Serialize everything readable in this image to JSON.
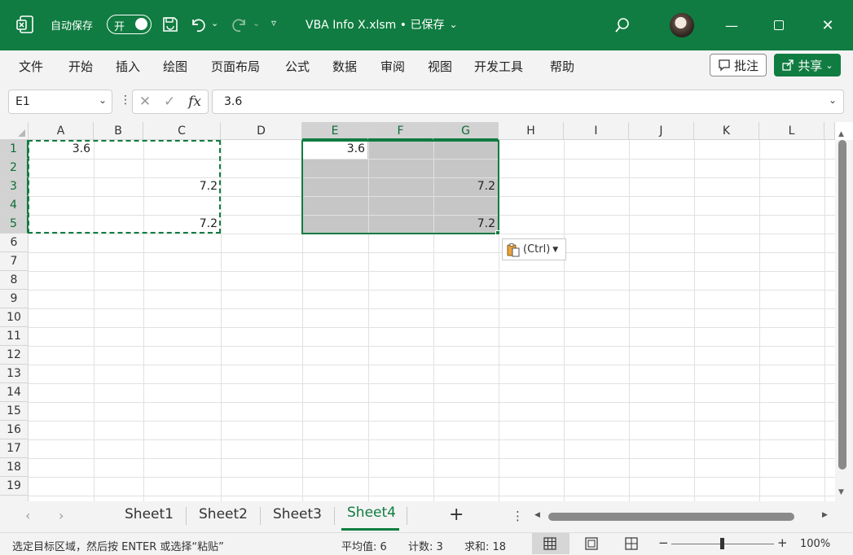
{
  "titlebar": {
    "autosave_label": "自动保存",
    "autosave_state": "开",
    "doc_title": "VBA Info X.xlsm • 已保存",
    "accent_color": "#107c41"
  },
  "menu": [
    "文件",
    "开始",
    "插入",
    "绘图",
    "页面布局",
    "公式",
    "数据",
    "审阅",
    "视图",
    "开发工具",
    "帮助"
  ],
  "actions": {
    "comment": "批注",
    "share": "共享"
  },
  "formula_bar": {
    "name_box": "E1",
    "formula": "3.6",
    "fx": "fx"
  },
  "grid": {
    "columns": [
      "A",
      "B",
      "C",
      "D",
      "E",
      "F",
      "G",
      "H",
      "I",
      "J",
      "K",
      "L"
    ],
    "rows": [
      "1",
      "2",
      "3",
      "4",
      "5",
      "6",
      "7",
      "8",
      "9",
      "10",
      "11",
      "12",
      "13",
      "14",
      "15",
      "16",
      "17",
      "18",
      "19"
    ],
    "cells": {
      "A1": "3.6",
      "C3": "7.2",
      "C5": "7.2",
      "E1": "3.6",
      "G3": "7.2",
      "G5": "7.2"
    },
    "selected_columns": [
      "E",
      "F",
      "G"
    ],
    "selected_rows": [
      "1",
      "2",
      "3",
      "4",
      "5"
    ],
    "copy_range": "A1:C5",
    "selection_range": "E1:G5"
  },
  "paste_options": {
    "label": "(Ctrl)"
  },
  "sheets": {
    "tabs": [
      "Sheet1",
      "Sheet2",
      "Sheet3",
      "Sheet4"
    ],
    "active": "Sheet4"
  },
  "status": {
    "message": "选定目标区域，然后按 ENTER 或选择“粘贴”",
    "average": "平均值: 6",
    "count": "计数: 3",
    "sum": "求和: 18",
    "zoom": "100%"
  }
}
